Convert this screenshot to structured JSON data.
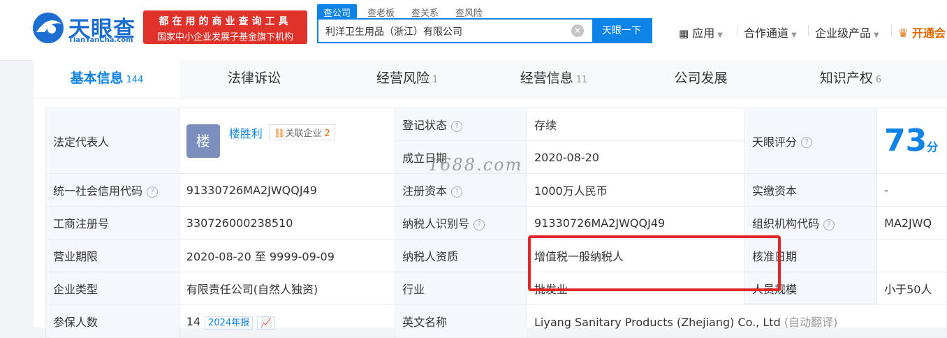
{
  "logo": {
    "name": "天眼查",
    "sub": "TianYanCha.com"
  },
  "banner": {
    "line1": "都在用的商业查询工具",
    "line2": "国家中小企业发展子基金旗下机构"
  },
  "search_tabs": [
    "查公司",
    "查老板",
    "查关系",
    "查风险"
  ],
  "search": {
    "value": "利洋卫生用品（浙江）有限公司",
    "button": "天眼一下"
  },
  "nav": {
    "apps": "应用",
    "partner": "合作通道",
    "enterprise": "企业级产品",
    "vip": "开通会"
  },
  "tabs": [
    {
      "label": "基本信息",
      "count": "144"
    },
    {
      "label": "法律诉讼",
      "count": ""
    },
    {
      "label": "经营风险",
      "count": "1"
    },
    {
      "label": "经营信息",
      "count": "11"
    },
    {
      "label": "公司发展",
      "count": ""
    },
    {
      "label": "知识产权",
      "count": "6"
    }
  ],
  "info": {
    "legal_rep_label": "法定代表人",
    "avatar_char": "楼",
    "legal_rep_name": "楼胜利",
    "related_label": "关联企业",
    "related_count": "2",
    "reg_status_label": "登记状态",
    "reg_status": "存续",
    "found_date_label": "成立日期",
    "found_date": "2020-08-20",
    "score_label": "天眼评分",
    "score": "73",
    "score_unit": "分",
    "credit_code_label": "统一社会信用代码",
    "credit_code": "91330726MA2JWQQJ49",
    "reg_capital_label": "注册资本",
    "reg_capital": "1000万人民币",
    "paid_capital_label": "实缴资本",
    "paid_capital": "-",
    "biz_reg_no_label": "工商注册号",
    "biz_reg_no": "330726000238510",
    "taxpayer_id_label": "纳税人识别号",
    "taxpayer_id": "91330726MA2JWQQJ49",
    "org_code_label": "组织机构代码",
    "org_code": "MA2JWQ",
    "term_label": "营业期限",
    "term": "2020-08-20 至 9999-09-09",
    "taxpayer_qual_label": "纳税人资质",
    "taxpayer_qual": "增值税一般纳税人",
    "approve_date_label": "核准日期",
    "approve_date": "",
    "company_type_label": "企业类型",
    "company_type": "有限责任公司(自然人独资)",
    "industry_label": "行业",
    "industry": "批发业",
    "staff_size_label": "人员规模",
    "staff_size": "小于50人",
    "insured_label": "参保人数",
    "insured": "14",
    "insured_report": "2024年报",
    "english_name_label": "英文名称",
    "english_name": "Liyang Sanitary Products (Zhejiang) Co., Ltd",
    "auto_translate": "(自动翻译)"
  },
  "watermark": "1688.com",
  "colors": {
    "accent": "#0e84e8",
    "banner": "#e0322a",
    "highlight_box": "#e02626",
    "status_green": "#2aa23c"
  }
}
